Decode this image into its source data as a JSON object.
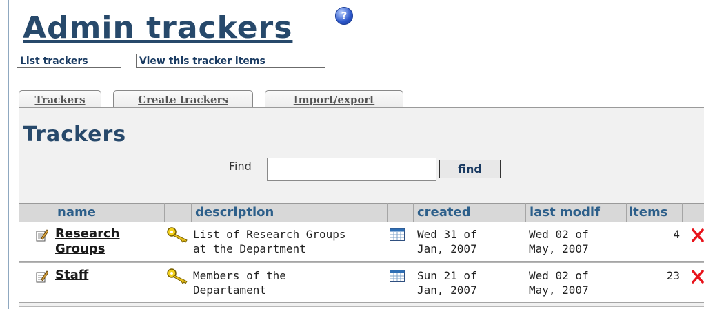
{
  "page": {
    "title": "Admin trackers",
    "help_icon": "help-icon"
  },
  "topbuttons": {
    "list_trackers": "List trackers",
    "view_items": "View this tracker items"
  },
  "tabs": [
    {
      "label": "Trackers"
    },
    {
      "label": "Create trackers"
    },
    {
      "label": "Import/export"
    }
  ],
  "section": {
    "heading": "Trackers",
    "find_label": "Find",
    "find_value": "",
    "find_button": "find"
  },
  "table": {
    "headers": {
      "name": "name",
      "description": "description",
      "created": "created",
      "last_modif": "last modif",
      "items": "items"
    },
    "rows": [
      {
        "name_line1": "Research",
        "name_line2": "Groups",
        "desc_line1": "List of Research Groups",
        "desc_line2": "at the Department",
        "created_line1": "Wed 31 of",
        "created_line2": "Jan, 2007",
        "modif_line1": "Wed 02 of",
        "modif_line2": "May, 2007",
        "items": "4"
      },
      {
        "name_line1": "Staff",
        "name_line2": "",
        "desc_line1": "Members of the",
        "desc_line2": "Departament",
        "created_line1": "Sun 21 of",
        "created_line2": "Jan, 2007",
        "modif_line1": "Wed 02 of",
        "modif_line2": "May, 2007",
        "items": "23"
      }
    ]
  },
  "colors": {
    "title": "#27496b",
    "header_link": "#2d5f8a",
    "delete": "#e8131b"
  }
}
